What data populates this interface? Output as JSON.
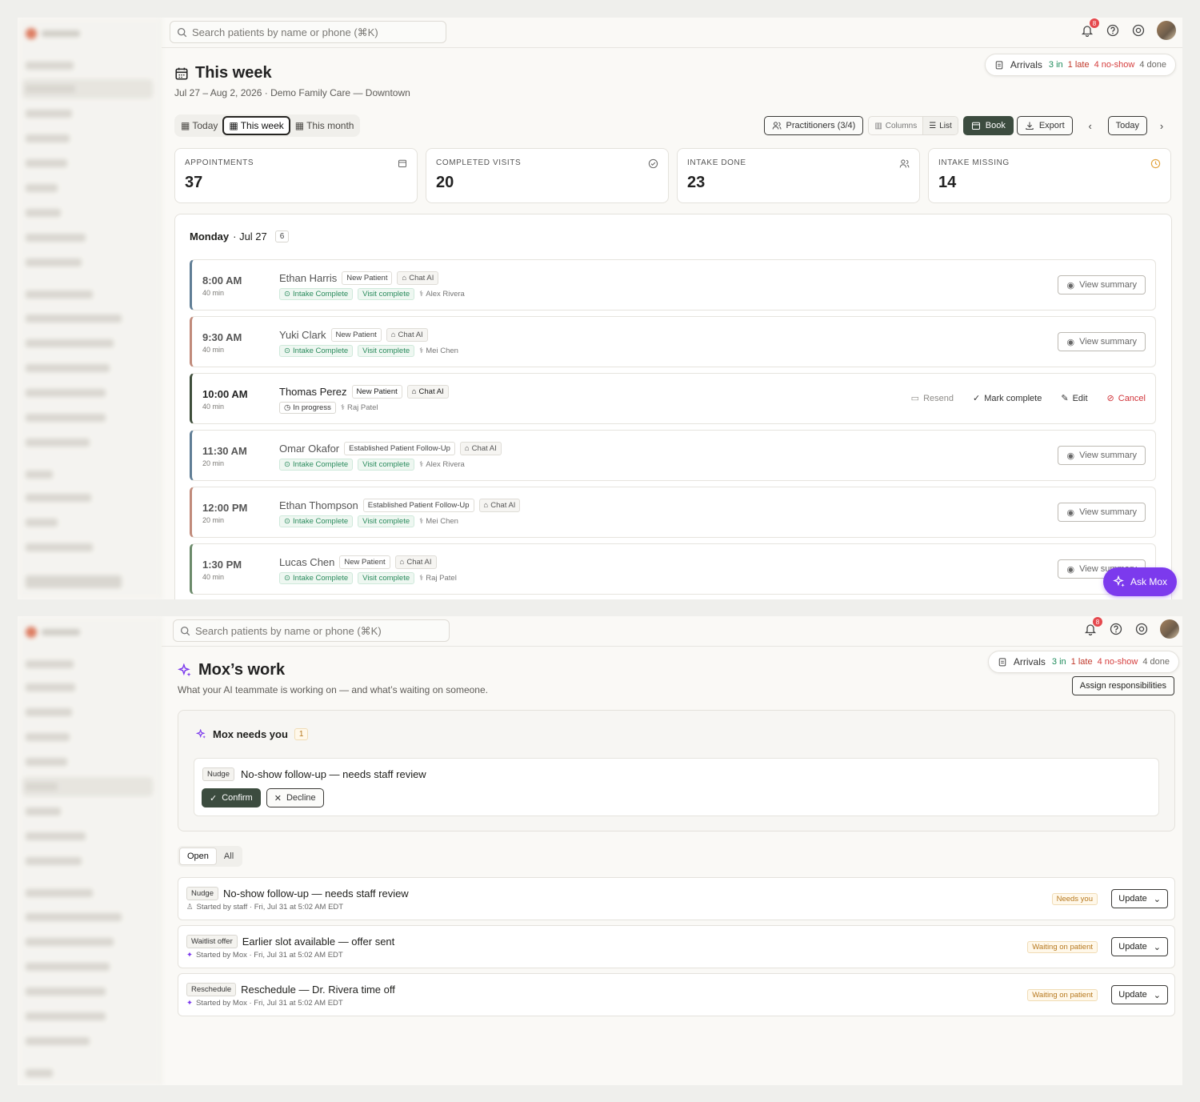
{
  "search": {
    "placeholder": "Search patients by name or phone (⌘K)"
  },
  "notifications": {
    "count": "8"
  },
  "arrivals": {
    "label": "Arrivals",
    "in": "3 in",
    "late": "1 late",
    "no_show": "4 no-show",
    "done": "4 done"
  },
  "schedule": {
    "title": "This week",
    "subtitle": "Jul 27 – Aug 2, 2026 · Demo Family Care — Downtown",
    "range_options": [
      "Today",
      "This week",
      "This month"
    ],
    "selected_range": "This week",
    "toolbar": {
      "practitioners": "Practitioners (3/4)",
      "columns": "Columns",
      "list": "List",
      "book": "Book",
      "export": "Export",
      "today": "Today"
    },
    "stats": [
      {
        "label": "Appointments",
        "value": "37",
        "icon": "calendar-icon"
      },
      {
        "label": "Completed visits",
        "value": "20",
        "icon": "check-circle-icon"
      },
      {
        "label": "Intake done",
        "value": "23",
        "icon": "users-icon"
      },
      {
        "label": "Intake missing",
        "value": "14",
        "icon": "clock-icon"
      }
    ],
    "day": {
      "name": "Monday",
      "date": "· Jul 27",
      "count": "6"
    },
    "appointments": [
      {
        "time": "8:00 AM",
        "duration": "40 min",
        "patient": "Ethan Harris",
        "visit_type": "New Patient",
        "source": "Chat AI",
        "intake": "Intake Complete",
        "status": "Visit complete",
        "practitioner": "Alex Rivera",
        "action": "View summary",
        "accent": "#5f7d95"
      },
      {
        "time": "9:30 AM",
        "duration": "40 min",
        "patient": "Yuki Clark",
        "visit_type": "New Patient",
        "source": "Chat AI",
        "intake": "Intake Complete",
        "status": "Visit complete",
        "practitioner": "Mei Chen",
        "action": "View summary",
        "accent": "#c08a7a"
      },
      {
        "time": "10:00 AM",
        "duration": "40 min",
        "patient": "Thomas Perez",
        "visit_type": "New Patient",
        "source": "Chat AI",
        "progress": "In progress",
        "practitioner": "Raj Patel",
        "actions": {
          "resend": "Resend",
          "mark_complete": "Mark complete",
          "edit": "Edit",
          "cancel": "Cancel"
        },
        "accent": "#3d4d3a"
      },
      {
        "time": "11:30 AM",
        "duration": "20 min",
        "patient": "Omar Okafor",
        "visit_type": "Established Patient Follow-Up",
        "source": "Chat AI",
        "intake": "Intake Complete",
        "status": "Visit complete",
        "practitioner": "Alex Rivera",
        "action": "View summary",
        "accent": "#5f7d95"
      },
      {
        "time": "12:00 PM",
        "duration": "20 min",
        "patient": "Ethan Thompson",
        "visit_type": "Established Patient Follow-Up",
        "source": "Chat AI",
        "intake": "Intake Complete",
        "status": "Visit complete",
        "practitioner": "Mei Chen",
        "action": "View summary",
        "accent": "#c08a7a"
      },
      {
        "time": "1:30 PM",
        "duration": "40 min",
        "patient": "Lucas Chen",
        "visit_type": "New Patient",
        "source": "Chat AI",
        "intake": "Intake Complete",
        "status": "Visit complete",
        "practitioner": "Raj Patel",
        "action": "View summary",
        "accent": "#6b8a6a"
      }
    ],
    "ask_mox": "Ask Mox"
  },
  "mox": {
    "title": "Mox’s work",
    "subtitle": "What your AI teammate is working on — and what’s waiting on someone.",
    "assign": "Assign responsibilities",
    "needs_you": {
      "label": "Mox needs you",
      "count": "1"
    },
    "card": {
      "tag": "Nudge",
      "title": "No-show follow-up — needs staff review",
      "confirm": "Confirm",
      "decline": "Decline"
    },
    "tabs": [
      "Open",
      "All"
    ],
    "tasks": [
      {
        "tag": "Nudge",
        "title": "No-show follow-up — needs staff review",
        "meta": "Started by staff · Fri, Jul 31 at 5:02 AM EDT",
        "starter_icon": "user-icon",
        "status": "Needs you",
        "update": "Update"
      },
      {
        "tag": "Waitlist offer",
        "title": "Earlier slot available — offer sent",
        "meta": "Started by Mox · Fri, Jul 31 at 5:02 AM EDT",
        "starter_icon": "sparkle-icon",
        "status": "Waiting on patient",
        "update": "Update"
      },
      {
        "tag": "Reschedule",
        "title": "Reschedule — Dr. Rivera time off",
        "meta": "Started by Mox · Fri, Jul 31 at 5:02 AM EDT",
        "starter_icon": "sparkle-icon",
        "status": "Waiting on patient",
        "update": "Update"
      }
    ]
  },
  "colors": {
    "accent_dark": "#3c4c3f",
    "mox_purple": "#7c3aed",
    "success": "#2a8b5d",
    "danger": "#d1343a",
    "warning": "#b7791f"
  }
}
